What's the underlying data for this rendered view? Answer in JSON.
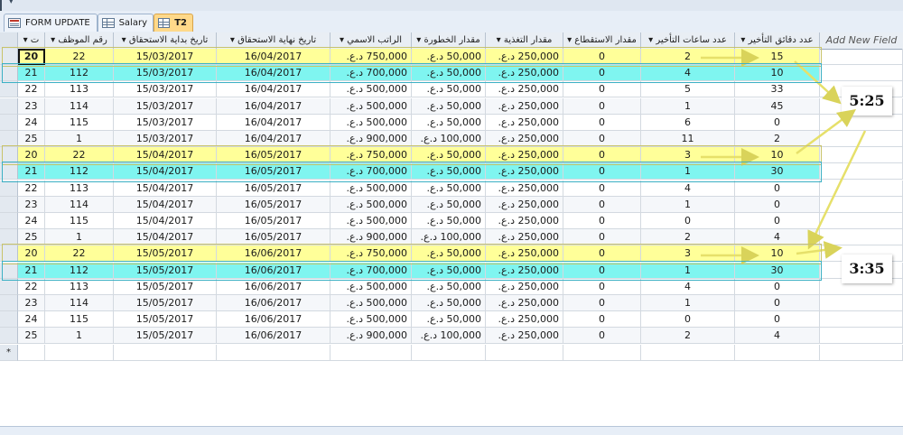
{
  "tabs": [
    {
      "label": "FORM UPDATE",
      "icon": "form-icon"
    },
    {
      "label": "Salary",
      "icon": "table-icon"
    },
    {
      "label": "T2",
      "icon": "table-icon",
      "active": true
    }
  ],
  "columns": [
    {
      "label": "ت",
      "sort": "▾"
    },
    {
      "label": "رقم الموظف",
      "sort": "▾"
    },
    {
      "label": "تاريخ بداية الاستحقاق",
      "sort": "▾"
    },
    {
      "label": "تاريخ نهاية الاستحقاق",
      "sort": "▾"
    },
    {
      "label": "الراتب الاسمي",
      "sort": "▾"
    },
    {
      "label": "مقدار الخطورة",
      "sort": "▾"
    },
    {
      "label": "مقدار التغذية",
      "sort": "▾"
    },
    {
      "label": "مقدار الاستقطاع",
      "sort": "▾"
    },
    {
      "label": "عدد ساعات التأخير",
      "sort": "▾"
    },
    {
      "label": "عدد دقائق التأخير",
      "sort": "▾"
    }
  ],
  "add_field_label": "Add New Field",
  "rows": [
    {
      "t": "20",
      "emp": "22",
      "start": "15/03/2017",
      "end": "16/04/2017",
      "salary": "750,000 د.ع.",
      "risk": "50,000 د.ع.",
      "food": "250,000 د.ع.",
      "deduct": "0",
      "hours": "2",
      "minutes": "15",
      "hl": "yellow"
    },
    {
      "t": "21",
      "emp": "112",
      "start": "15/03/2017",
      "end": "16/04/2017",
      "salary": "700,000 د.ع.",
      "risk": "50,000 د.ع.",
      "food": "250,000 د.ع.",
      "deduct": "0",
      "hours": "4",
      "minutes": "10",
      "hl": "cyan"
    },
    {
      "t": "22",
      "emp": "113",
      "start": "15/03/2017",
      "end": "16/04/2017",
      "salary": "500,000 د.ع.",
      "risk": "50,000 د.ع.",
      "food": "250,000 د.ع.",
      "deduct": "0",
      "hours": "5",
      "minutes": "33",
      "hl": ""
    },
    {
      "t": "23",
      "emp": "114",
      "start": "15/03/2017",
      "end": "16/04/2017",
      "salary": "500,000 د.ع.",
      "risk": "50,000 د.ع.",
      "food": "250,000 د.ع.",
      "deduct": "0",
      "hours": "1",
      "minutes": "45",
      "hl": ""
    },
    {
      "t": "24",
      "emp": "115",
      "start": "15/03/2017",
      "end": "16/04/2017",
      "salary": "500,000 د.ع.",
      "risk": "50,000 د.ع.",
      "food": "250,000 د.ع.",
      "deduct": "0",
      "hours": "6",
      "minutes": "0",
      "hl": ""
    },
    {
      "t": "25",
      "emp": "1",
      "start": "15/03/2017",
      "end": "16/04/2017",
      "salary": "900,000 د.ع.",
      "risk": "100,000 د.ع.",
      "food": "250,000 د.ع.",
      "deduct": "0",
      "hours": "11",
      "minutes": "2",
      "hl": ""
    },
    {
      "t": "20",
      "emp": "22",
      "start": "15/04/2017",
      "end": "16/05/2017",
      "salary": "750,000 د.ع.",
      "risk": "50,000 د.ع.",
      "food": "250,000 د.ع.",
      "deduct": "0",
      "hours": "3",
      "minutes": "10",
      "hl": "yellow"
    },
    {
      "t": "21",
      "emp": "112",
      "start": "15/04/2017",
      "end": "16/05/2017",
      "salary": "700,000 د.ع.",
      "risk": "50,000 د.ع.",
      "food": "250,000 د.ع.",
      "deduct": "0",
      "hours": "1",
      "minutes": "30",
      "hl": "cyan"
    },
    {
      "t": "22",
      "emp": "113",
      "start": "15/04/2017",
      "end": "16/05/2017",
      "salary": "500,000 د.ع.",
      "risk": "50,000 د.ع.",
      "food": "250,000 د.ع.",
      "deduct": "0",
      "hours": "4",
      "minutes": "0",
      "hl": ""
    },
    {
      "t": "23",
      "emp": "114",
      "start": "15/04/2017",
      "end": "16/05/2017",
      "salary": "500,000 د.ع.",
      "risk": "50,000 د.ع.",
      "food": "250,000 د.ع.",
      "deduct": "0",
      "hours": "1",
      "minutes": "0",
      "hl": ""
    },
    {
      "t": "24",
      "emp": "115",
      "start": "15/04/2017",
      "end": "16/05/2017",
      "salary": "500,000 د.ع.",
      "risk": "50,000 د.ع.",
      "food": "250,000 د.ع.",
      "deduct": "0",
      "hours": "0",
      "minutes": "0",
      "hl": ""
    },
    {
      "t": "25",
      "emp": "1",
      "start": "15/04/2017",
      "end": "16/05/2017",
      "salary": "900,000 د.ع.",
      "risk": "100,000 د.ع.",
      "food": "250,000 د.ع.",
      "deduct": "0",
      "hours": "2",
      "minutes": "4",
      "hl": ""
    },
    {
      "t": "20",
      "emp": "22",
      "start": "15/05/2017",
      "end": "16/06/2017",
      "salary": "750,000 د.ع.",
      "risk": "50,000 د.ع.",
      "food": "250,000 د.ع.",
      "deduct": "0",
      "hours": "3",
      "minutes": "10",
      "hl": "yellow"
    },
    {
      "t": "21",
      "emp": "112",
      "start": "15/05/2017",
      "end": "16/06/2017",
      "salary": "700,000 د.ع.",
      "risk": "50,000 د.ع.",
      "food": "250,000 د.ع.",
      "deduct": "0",
      "hours": "1",
      "minutes": "30",
      "hl": "cyan"
    },
    {
      "t": "22",
      "emp": "113",
      "start": "15/05/2017",
      "end": "16/06/2017",
      "salary": "500,000 د.ع.",
      "risk": "50,000 د.ع.",
      "food": "250,000 د.ع.",
      "deduct": "0",
      "hours": "4",
      "minutes": "0",
      "hl": ""
    },
    {
      "t": "23",
      "emp": "114",
      "start": "15/05/2017",
      "end": "16/06/2017",
      "salary": "500,000 د.ع.",
      "risk": "50,000 د.ع.",
      "food": "250,000 د.ع.",
      "deduct": "0",
      "hours": "1",
      "minutes": "0",
      "hl": ""
    },
    {
      "t": "24",
      "emp": "115",
      "start": "15/05/2017",
      "end": "16/06/2017",
      "salary": "500,000 د.ع.",
      "risk": "50,000 د.ع.",
      "food": "250,000 د.ع.",
      "deduct": "0",
      "hours": "0",
      "minutes": "0",
      "hl": ""
    },
    {
      "t": "25",
      "emp": "1",
      "start": "15/05/2017",
      "end": "16/06/2017",
      "salary": "900,000 د.ع.",
      "risk": "100,000 د.ع.",
      "food": "250,000 د.ع.",
      "deduct": "0",
      "hours": "2",
      "minutes": "4",
      "hl": ""
    }
  ],
  "new_row_marker": "*",
  "callouts": [
    "5:25",
    "3:35"
  ],
  "colors": {
    "highlight_yellow": "#ffff99",
    "highlight_cyan": "#7ff5f0",
    "active_tab": "#ffd98a",
    "arrow": "#e6e06a"
  }
}
